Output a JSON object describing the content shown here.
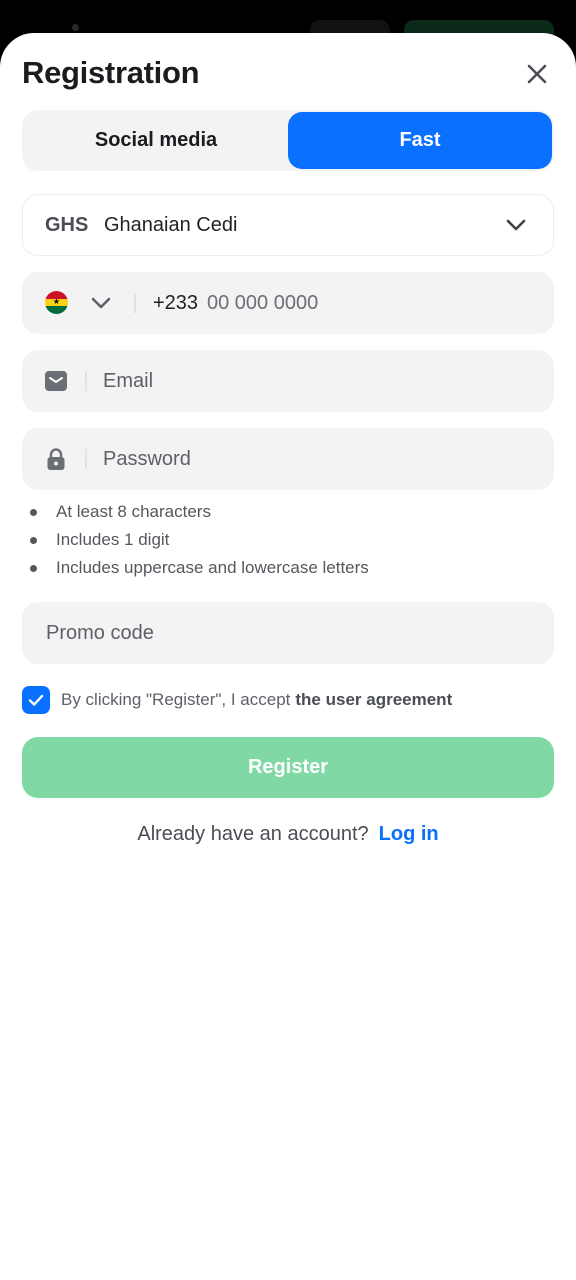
{
  "header": {
    "title": "Registration"
  },
  "tabs": [
    {
      "label": "Social media",
      "active": false
    },
    {
      "label": "Fast",
      "active": true
    }
  ],
  "currency": {
    "code": "GHS",
    "name": "Ghanaian Cedi"
  },
  "phone": {
    "prefix": "+233",
    "placeholder": "00 000 0000",
    "flag": "ghana-flag-icon"
  },
  "email": {
    "placeholder": "Email",
    "icon": "mail-icon"
  },
  "password": {
    "placeholder": "Password",
    "icon": "lock-icon"
  },
  "password_rules": [
    "At least 8 characters",
    "Includes 1 digit",
    "Includes uppercase and lowercase letters"
  ],
  "promo": {
    "placeholder": "Promo code"
  },
  "agreement": {
    "text": "By clicking \"Register\", I accept",
    "link": "the user agreement",
    "checked": true
  },
  "register": {
    "label": "Register"
  },
  "login": {
    "prompt": "Already have an account?",
    "link": "Log in"
  },
  "colors": {
    "accent": "#0a70ff",
    "register_bg": "#80d9a4",
    "field_bg": "#f3f3f4"
  }
}
